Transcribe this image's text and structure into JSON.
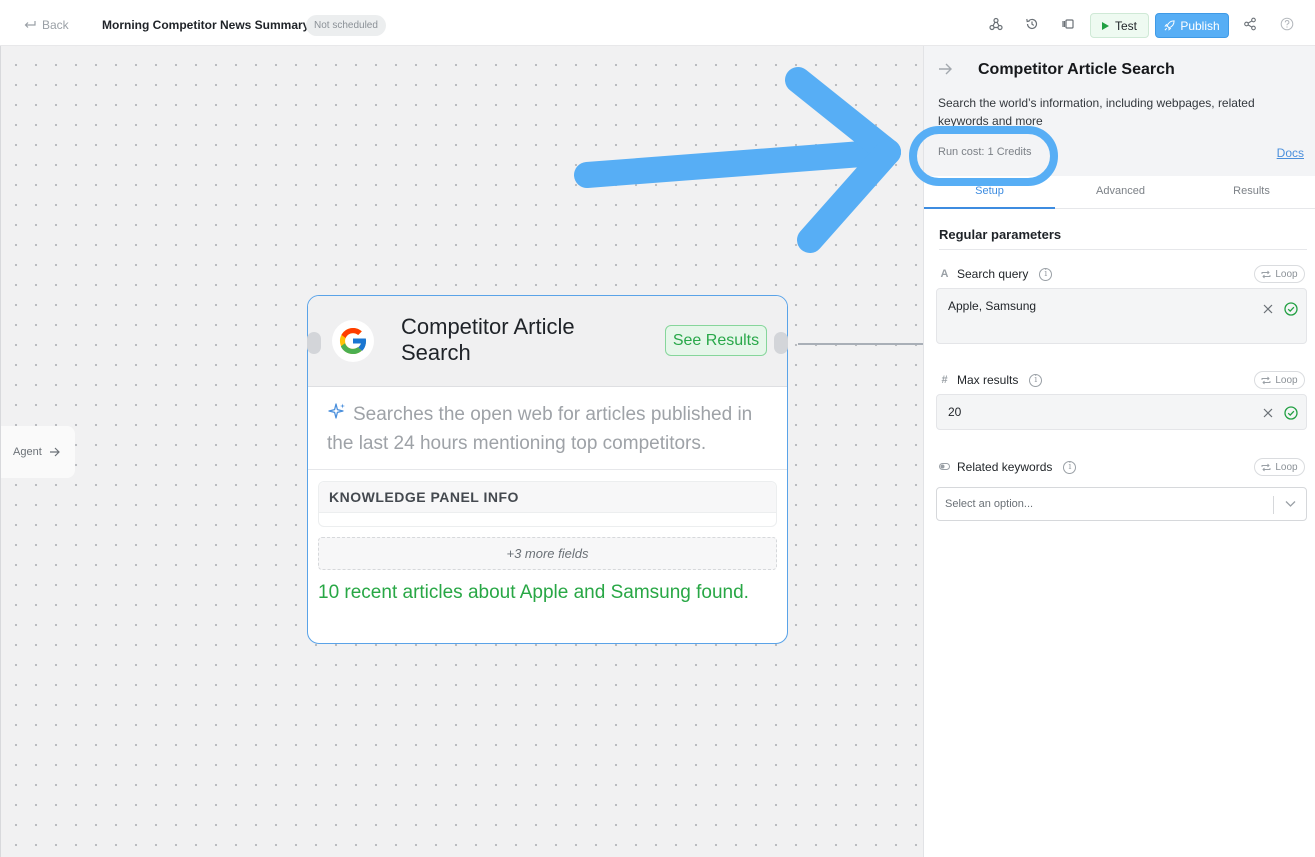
{
  "topbar": {
    "back_label": "Back",
    "workflow_title": "Morning Competitor News Summary",
    "schedule_badge": "Not scheduled",
    "test_label": "Test",
    "publish_label": "Publish",
    "icons": [
      "webhook-icon",
      "history-icon",
      "layout-icon",
      "share-icon",
      "help-icon"
    ]
  },
  "canvas": {
    "agent_stub_label": "Agent",
    "node": {
      "title": "Competitor Article Search",
      "see_results_label": "See Results",
      "description": "Searches the open web for articles published in the last 24 hours mentioning top competitors.",
      "knowledge_panel_header": "KNOWLEDGE PANEL INFO",
      "more_fields_label": "+3 more fields",
      "result_text": "10 recent articles about Apple and Samsung found."
    }
  },
  "panel": {
    "title": "Competitor Article Search",
    "description": "Search the world’s information, including webpages, related keywords and more",
    "run_cost": "Run cost: 1 Credits",
    "docs_label": "Docs",
    "tabs": [
      {
        "label": "Setup",
        "active": true
      },
      {
        "label": "Advanced",
        "active": false
      },
      {
        "label": "Results",
        "active": false
      }
    ],
    "section_title": "Regular parameters",
    "fields": {
      "search_query": {
        "label": "Search query",
        "value": "Apple, Samsung",
        "icon": "A",
        "loop_label": "Loop"
      },
      "max_results": {
        "label": "Max results",
        "value": "20",
        "icon": "#",
        "loop_label": "Loop"
      },
      "related_keywords": {
        "label": "Related keywords",
        "placeholder": "Select an option...",
        "loop_label": "Loop"
      }
    }
  },
  "colors": {
    "accent_blue": "#57aef5",
    "success_green": "#28a745",
    "annotation_blue": "#57aef5"
  }
}
